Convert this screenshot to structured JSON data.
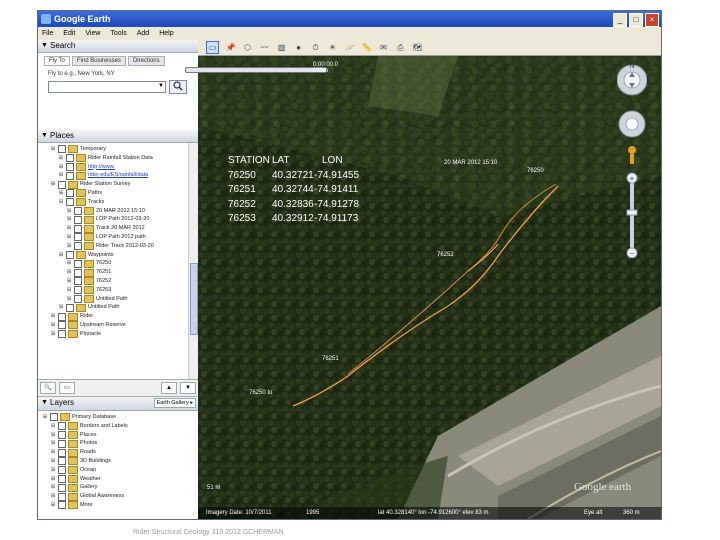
{
  "window": {
    "title": "Google Earth",
    "min": "_",
    "max": "□",
    "close": "×"
  },
  "menu": [
    "File",
    "Edit",
    "View",
    "Tools",
    "Add",
    "Help"
  ],
  "search": {
    "title": "Search",
    "tabs": [
      "Fly To",
      "Find Businesses",
      "Directions"
    ],
    "hint": "Fly to e.g., New York, NY",
    "button_icon": "search-icon"
  },
  "places": {
    "title": "Places",
    "rows": [
      {
        "text": "Temporary",
        "indent": 1
      },
      {
        "text": "Rider Rainfall Station Data",
        "indent": 2
      },
      {
        "text": "http://www.",
        "indent": 2,
        "link": true
      },
      {
        "text": "rider.edu/ES/rainfall/data",
        "indent": 2,
        "link": true
      },
      {
        "text": "Rider Station Survey",
        "indent": 1
      },
      {
        "text": "Paths",
        "indent": 2
      },
      {
        "text": "Tracks",
        "indent": 2
      },
      {
        "text": "20 MAR 2012 15:10",
        "indent": 3
      },
      {
        "text": "LOP Path 2012-03-20",
        "indent": 3
      },
      {
        "text": "Track 20 MAR 2012",
        "indent": 3
      },
      {
        "text": "LOP Path 2012 path",
        "indent": 3
      },
      {
        "text": "Rider Track 2012-03-20",
        "indent": 3
      },
      {
        "text": "Waypoints",
        "indent": 2
      },
      {
        "text": "76250",
        "indent": 3
      },
      {
        "text": "76251",
        "indent": 3
      },
      {
        "text": "76252",
        "indent": 3
      },
      {
        "text": "76253",
        "indent": 3
      },
      {
        "text": "Untitled Path",
        "indent": 3
      },
      {
        "text": "Untitled Path",
        "indent": 2
      },
      {
        "text": "Rider",
        "indent": 1
      },
      {
        "text": "Upstream Reserve",
        "indent": 1
      },
      {
        "text": "Pinnacle",
        "indent": 1
      }
    ]
  },
  "tools": {
    "up": "▲",
    "down": "▼",
    "earth_gallery": "Earth Gallery ▸"
  },
  "layers": {
    "title": "Layers",
    "rows": [
      {
        "text": "Primary Database",
        "indent": 0
      },
      {
        "text": "Borders and Labels",
        "indent": 1
      },
      {
        "text": "Places",
        "indent": 1
      },
      {
        "text": "Photos",
        "indent": 1
      },
      {
        "text": "Roads",
        "indent": 1
      },
      {
        "text": "3D Buildings",
        "indent": 1
      },
      {
        "text": "Ocean",
        "indent": 1
      },
      {
        "text": "Weather",
        "indent": 1
      },
      {
        "text": "Gallery",
        "indent": 1
      },
      {
        "text": "Global Awareness",
        "indent": 1
      },
      {
        "text": "More",
        "indent": 1
      }
    ]
  },
  "overlay": {
    "header": [
      "STATION",
      "LAT",
      "LON"
    ],
    "rows": [
      [
        "76250",
        "40.32721",
        "-74.91455"
      ],
      [
        "76251",
        "40.32744",
        "-74.91411"
      ],
      [
        "76252",
        "40.32836",
        "-74.91278"
      ],
      [
        "76253",
        "40.32912",
        "-74.91173"
      ]
    ]
  },
  "map_labels": {
    "track": "20 MAR 2012 15:10",
    "w1": "76250",
    "w2": "76252",
    "w3": "76251",
    "w4": "76250 to",
    "tour_time": "0:00:00.0 / 19m"
  },
  "status": {
    "imagery": "Imagery Date: 10/7/2011",
    "year": "1995",
    "coords": "lat 40.328140° lon -74.912600° elev 83 m",
    "eye": "Eye alt",
    "eye_val": "360 m",
    "scale": "51 m",
    "logo": "Google earth"
  },
  "footer": "Rider Structural Geology 310 2012 GCHERMAN",
  "colors": {
    "track": "#f0a050",
    "titlebar": "#1c48b8",
    "forest": "#1e2a14"
  }
}
